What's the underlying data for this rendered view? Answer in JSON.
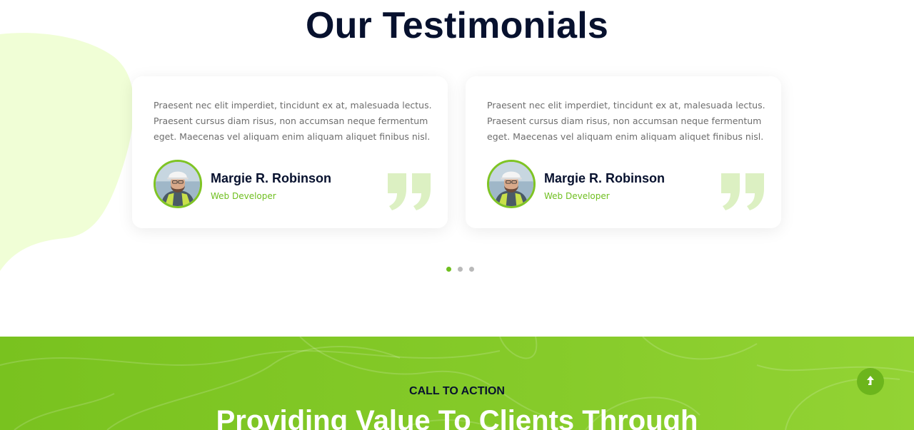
{
  "testimonials": {
    "title": "Our Testimonials",
    "items": [
      {
        "text": "Praesent nec elit imperdiet, tincidunt ex at, malesuada lectus. Praesent cursus diam risus, non accumsan neque fermentum eget. Maecenas vel aliquam enim aliquam aliquet finibus nisl.",
        "name": "Margie R. Robinson",
        "role": "Web Developer",
        "avatar_icon": "worker-avatar",
        "quote_icon": "quote-icon"
      },
      {
        "text": "Praesent nec elit imperdiet, tincidunt ex at, malesuada lectus. Praesent cursus diam risus, non accumsan neque fermentum eget. Maecenas vel aliquam enim aliquam aliquet finibus nisl.",
        "name": "Margie R. Robinson",
        "role": "Web Developer",
        "avatar_icon": "worker-avatar",
        "quote_icon": "quote-icon"
      }
    ],
    "pagination": {
      "count": 3,
      "active_index": 0
    }
  },
  "cta": {
    "eyebrow": "CALL TO ACTION",
    "heading": "Providing Value To Clients Through"
  },
  "scroll_top": {
    "icon": "arrow-up-icon"
  },
  "colors": {
    "accent": "#7fc424",
    "navy": "#07112e",
    "blob": "#f0fed6",
    "body_text": "#6d6d6d"
  }
}
